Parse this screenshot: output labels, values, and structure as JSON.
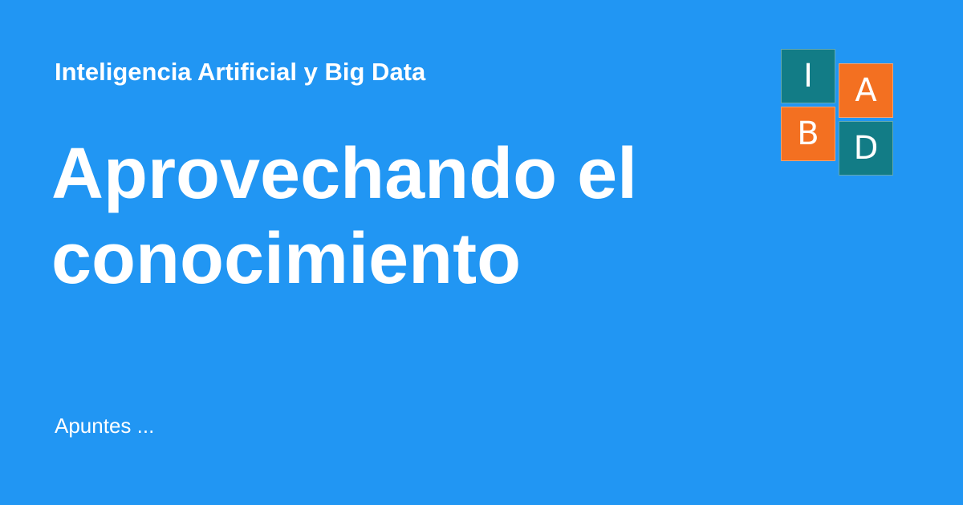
{
  "site": {
    "name": "Inteligencia Artificial y Big Data"
  },
  "page": {
    "title": "Aprovechando el conocimiento",
    "description": "Apuntes ..."
  },
  "logo": {
    "tiles": [
      {
        "letter": "I",
        "color": "#127c86"
      },
      {
        "letter": "A",
        "color": "#f37021"
      },
      {
        "letter": "B",
        "color": "#f37021"
      },
      {
        "letter": "D",
        "color": "#127c86"
      }
    ]
  },
  "colors": {
    "background": "#2196f3",
    "text": "#ffffff",
    "teal": "#127c86",
    "orange": "#f37021"
  }
}
